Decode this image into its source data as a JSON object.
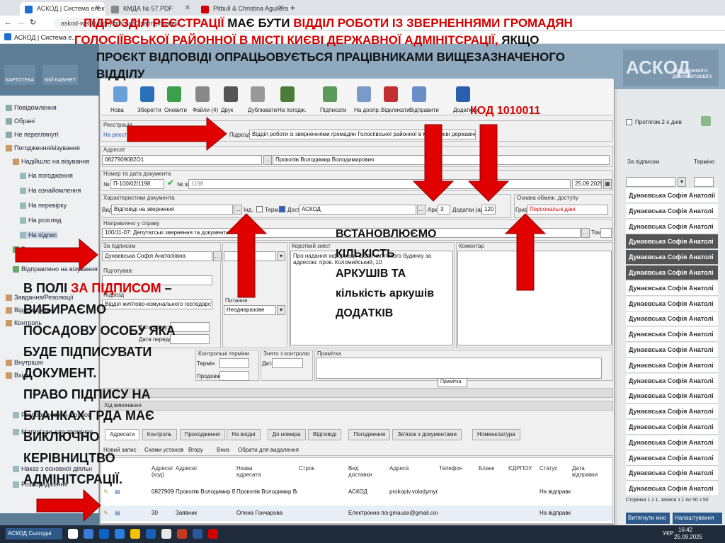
{
  "browser": {
    "tabs": [
      {
        "title": "АСКОД | Система електронн",
        "fav": "#1a6fd1"
      },
      {
        "title": "КМДА № 57.PDF",
        "fav": "#888888"
      },
      {
        "title": "Pitbull & Christina Aguilera",
        "fav": "#d40000"
      }
    ],
    "url": "askod-webkyivcity.gov.ua/C/sa/mainpage/",
    "bookmark": "АСКОД | Система е..."
  },
  "app": {
    "sidebar_top": [
      "КАРТОТЕКА",
      "МІЙ КАБІНЕТ"
    ],
    "logo_lines": [
      "ЕЛЕКТРОННОГО",
      "ДОКУМЕНТООБІГУ"
    ],
    "logo_big": "АСКОД",
    "nav": [
      "Повідомлення",
      "Обрані",
      "Не переглянуті",
      "Погодження/візування",
      "Надійшло на візування",
      "На погодження",
      "На ознайомлення",
      "На перевірку",
      "На розгляд",
      "На підпис",
      "Виконане погодження",
      "Відправлено на візування",
      "Завдання/Резолюції",
      "Відповідальні",
      "Контроль",
      "Внутрішні",
      "Вхідні",
      "Розпорядження з основ",
      "Матеріали для термінов",
      "Наказ з основної діяльн",
      "Розпорядження"
    ],
    "right_panel": {
      "filter": "Протягом 2-х днів",
      "col1": "За підписом",
      "col2": "Терміно",
      "rows": [
        "Дунаєвська Софія Анатолії",
        "Дунаєвська Софія Анатолі",
        "Дунаєвська Софія Анатолі",
        "Дунаєвська Софія Анатолі",
        "Дунаєвська Софія Анатолі",
        "Дунаєвська Софія Анатолі",
        "Дунаєвська Софія Анатолі",
        "Дунаєвська Софія Анатолі",
        "Дунаєвська Софія Анатолі",
        "Дунаєвська Софія Анатолі",
        "Дунаєвська Софія Анатолі",
        "Дунаєвська Софія Анатолі",
        "Дунаєвська Софія Анатолі",
        "Дунаєвська Софія Анатолі",
        "Дунаєвська Софія Анатолі",
        "Дунаєвська Софія Анатолі",
        "Дунаєвська Софія Анатолі",
        "Дунаєвська Софія Анатолі",
        "Дунаєвська Софія Анатолі",
        "Дунаєвська Софія Анатолі"
      ],
      "pager": "Сторінка 1 з 1, записи з 1 по 50 з 50",
      "btn1": "Витягнути кіно",
      "btn2": "Налаштування"
    }
  },
  "toolbar": [
    "Нова",
    "Зберегти",
    "Оновити",
    "Файли (4)",
    "Друк",
    "Дублювати",
    "На погодж.",
    "Підписати",
    "На доопр.",
    "Відкликати",
    "Відправити",
    "Додатков"
  ],
  "form": {
    "registration_label": "Реєстрація",
    "registration_value": "На реєстрації",
    "dept_label": "Підрозділ",
    "dept_value": "Відділ роботи із зверненнями громадян Голосіївської районної в місті Києві державної адміністрації",
    "addressee_label": "Адресат",
    "addressee_code": "0827909082О1",
    "addressee_name": "Прокопів Володимир Володимирович",
    "number_label": "Номер та дата документа",
    "number_value": "П-100/02/1198",
    "sn_label": "№ з/п",
    "sn_value": "1198",
    "date_value": "25.09.2025",
    "char_label": "Характеристики документа",
    "kind_label": "Вид",
    "kind_value": "Відповіді на звернення",
    "ind_label": "Інд.",
    "term_label": "Терм.",
    "dost_label": "Дост.",
    "dost_value": "АСКОД",
    "ark_label": "Арк.",
    "ark_value": "3",
    "dod_label": "Додатки (арк.)",
    "dod_value": "120",
    "restrict_label": "Ознака обмеж. доступу",
    "grif_label": "Гриф",
    "grif_value": "Персональні дані",
    "send_label": "Направлено у справу",
    "send_value": "100/11-07: Депутатські звернення та документи з ї",
    "tom_label": "Том",
    "signer_label": "За підписом",
    "signer_value": "Дунаєвська Софія Анатоліївна",
    "prepared_label": "Підготував:",
    "podr_label": "Підрозд",
    "podr_value": "Відділ житлово-комунального господарст",
    "issue_label": "Питання",
    "issue_value": "Неоднаразове",
    "print_date_label": "Дата друку:",
    "send_date_label": "Дата передачі:",
    "summary_label": "Короткий зміст",
    "summary_value": "Про надання інформації щодо житлового будинку за адресою: пров. Коломийський, 10",
    "comment_label": "Коментар",
    "control_label": "Контрольні терміни",
    "term2_label": "Термін",
    "prodov_label": "Продовж.",
    "removed_label": "Знято з контролю",
    "date_label": "Дата",
    "note_label": "Примітка",
    "tooltip": "Примітка",
    "exec_label": "Хід виконання"
  },
  "bottom_tabs": [
    "Адресати",
    "Контроль",
    "Проходження",
    "На вхідні",
    "До номера",
    "Відповіді",
    "Погодження",
    "Зв'язок з документами",
    "Номенклатура"
  ],
  "bottom_toolbar": [
    "Новий запис",
    "Схеми установ",
    "Вгору",
    "Вниз",
    "Обрати для видалення"
  ],
  "table": {
    "headers": [
      "Адресат (код)",
      "Адресат",
      "Назва адресата",
      "Строк",
      "Вид доставки",
      "Адреса",
      "Телефон",
      "Бланк",
      "ЄДРПОУ",
      "Статус",
      "Дата відправки"
    ],
    "rows": [
      [
        "08279090",
        "Прокопів Володимир Вол",
        "Прокопів Володимир Вол",
        "",
        "АСКОД",
        "prokopiv.volodymyr@",
        "",
        "",
        "",
        "На відправку",
        ""
      ],
      [
        "30",
        "Заявник",
        "Олена Гончарова",
        "",
        "Електронна пош",
        "gmauax@gmail.com",
        "",
        "",
        "",
        "На відправку",
        ""
      ]
    ]
  },
  "overlay": {
    "title_lines": [
      [
        "ПІДРОЗДІЛ РЕЄСТРАЦІЇ",
        " МАЄ БУТИ ",
        "ВІДДІЛ РОБОТИ ІЗ ЗВЕРНЕННЯМИ ГРОМАДЯН"
      ],
      [
        "ГОЛОСІЇВСЬКОЇ РАЙОННОЇ В МІСТІ КИЄВІ ДЕРЖАВНОЇ АДМІНІТСРАЦІЇ,",
        " ЯКЩО"
      ],
      [
        "ПРОЄКТ ВІДПОВІДІ ОПРАЦЬОВУЄТЬСЯ ПРАЦІВНИКАМИ ВИЩЕЗАЗНАЧЕНОГО"
      ],
      [
        "ВІДДІЛУ"
      ]
    ],
    "code": "КОД 1010011",
    "sheets_note": [
      "ВСТАНОВЛЮЄМО",
      "КІЛЬКІСТЬ",
      "АРКУШІВ ТА",
      "кількість аркушів",
      "ДОДАТКІВ"
    ],
    "signer_note_a": "В ПОЛІ ",
    "signer_note_b": "ЗА ПІДПИСОМ",
    "signer_note_c": " –",
    "signer_note_lines": [
      "ВИБИРАЄМО",
      "ПОСАДОВУ ОСОБУ ЯКА",
      "БУДЕ ПІДПИСУВАТИ",
      "ДОКУМЕНТ.",
      "ПРАВО ПІДПИСУ НА",
      "БЛАНКАХ ГРДА МАЄ",
      "ВИКЛЮЧНО",
      "КЕРІВНИЦТВО",
      "АДМІНІТСРАЦІЇ."
    ]
  },
  "taskbar": {
    "time": "16:42",
    "date": "25.09.2025",
    "lang": "УКР",
    "left_btn": "АСКОД Сьогодні"
  },
  "colors": {
    "accent_red": "#d40000",
    "arrow_red": "#e00000",
    "app_blue": "#5d7c95"
  }
}
